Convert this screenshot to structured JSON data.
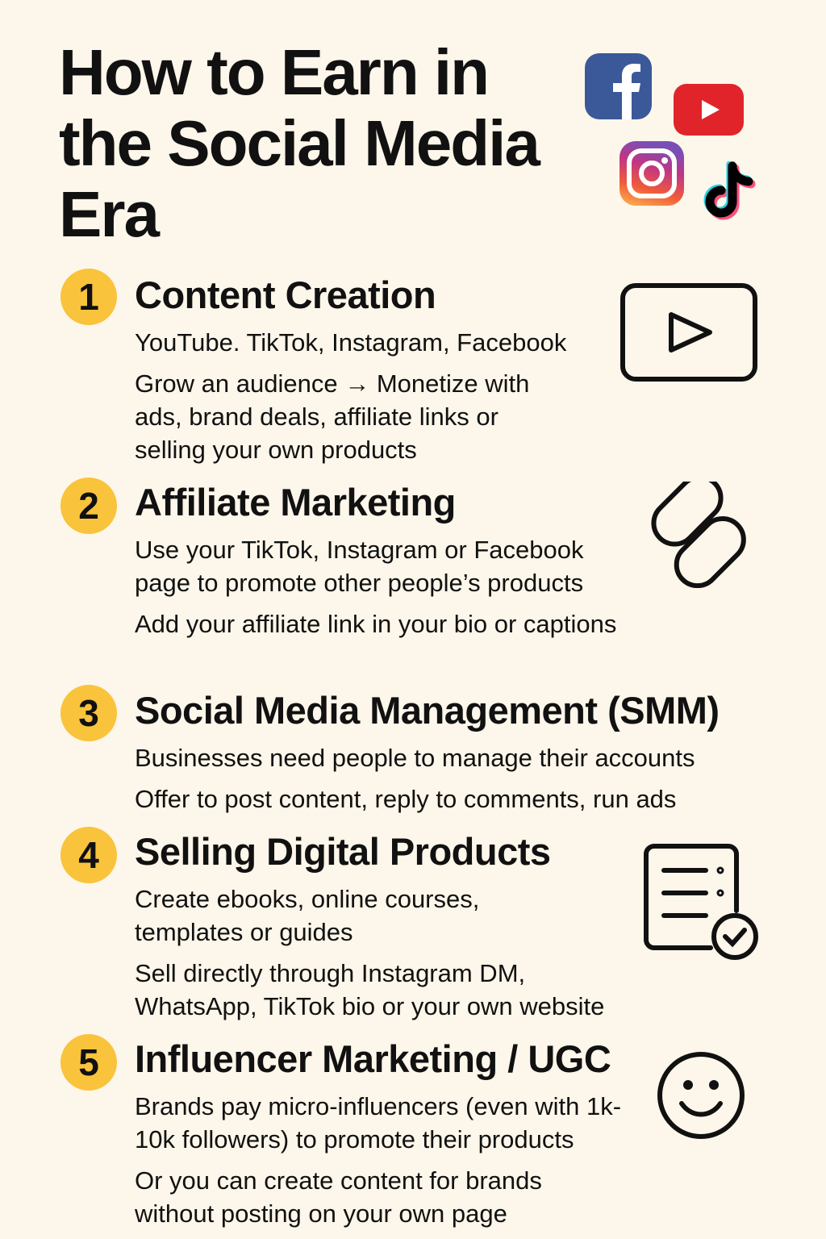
{
  "title": [
    "How to Earn in",
    "the Social Media",
    "Era"
  ],
  "logos": [
    "facebook-logo",
    "youtube-logo",
    "instagram-logo",
    "tiktok-logo"
  ],
  "colors": {
    "background": "#fdf6ea",
    "badge": "#f9c33c",
    "facebook": "#3b5998",
    "youtube": "#e0242a"
  },
  "sections": [
    {
      "number": "1",
      "heading": "Content Creation",
      "paragraphs": [
        "YouTube. TikTok, Instagram, Facebook",
        "Grow an audience → Monetize with ads, brand deals, affiliate links or selling your own products"
      ],
      "icon": "video-play-icon"
    },
    {
      "number": "2",
      "heading": "Affiliate Marketing",
      "paragraphs": [
        "Use your TikTok, Instagram or Facebook page to promote other people’s products",
        "Add your affiliate link in your bio or captions"
      ],
      "icon": "link-icon"
    },
    {
      "number": "3",
      "heading": "Social Media Management (SMM)",
      "paragraphs": [
        "Businesses need people to manage their accounts",
        "Offer to post content, reply to comments, run ads"
      ]
    },
    {
      "number": "4",
      "heading": "Selling Digital Products",
      "paragraphs": [
        "Create ebooks, online courses, templates or guides",
        "Sell directly through Instagram DM, WhatsApp, TikTok bio or your own website"
      ],
      "icon": "document-check-icon"
    },
    {
      "number": "5",
      "heading": "Influencer Marketing / UGC",
      "paragraphs": [
        "Brands pay micro-influencers (even with 1k-10k followers) to promote their products",
        "Or you can create content for brands without posting on your own page"
      ],
      "icon": "smiley-icon"
    }
  ]
}
